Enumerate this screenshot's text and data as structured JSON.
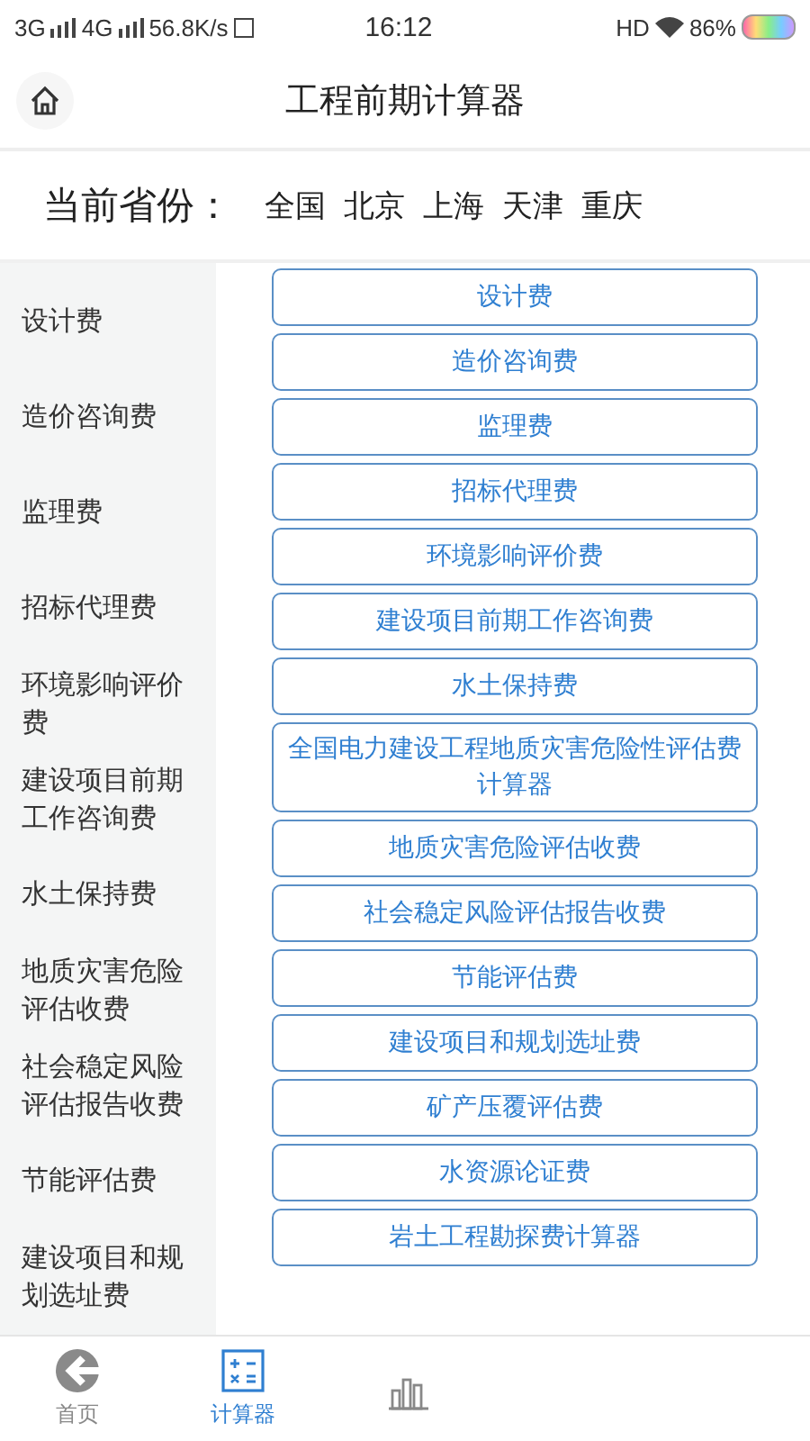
{
  "status_bar": {
    "network_1": "3G",
    "network_2": "4G",
    "speed": "56.8K/s",
    "time": "16:12",
    "hd": "HD",
    "battery": "86%"
  },
  "header": {
    "title": "工程前期计算器"
  },
  "province_bar": {
    "label": "当前省份：",
    "provinces": [
      "全国",
      "北京",
      "上海",
      "天津",
      "重庆"
    ]
  },
  "categories": [
    {
      "label": "设计费",
      "selected": false
    },
    {
      "label": "造价咨询费",
      "selected": false
    },
    {
      "label": "监理费",
      "selected": false
    },
    {
      "label": "招标代理费",
      "selected": false
    },
    {
      "label": "环境影响评价费",
      "selected": false
    },
    {
      "label": "建设项目前期工作咨询费",
      "selected": false
    },
    {
      "label": "水土保持费",
      "selected": false
    },
    {
      "label": "地质灾害危险评估收费",
      "selected": false
    },
    {
      "label": "社会稳定风险评估报告收费",
      "selected": false
    },
    {
      "label": "节能评估费",
      "selected": false
    },
    {
      "label": "建设项目和规划选址费",
      "selected": false
    }
  ],
  "calculators": [
    "设计费",
    "造价咨询费",
    "监理费",
    "招标代理费",
    "环境影响评价费",
    "建设项目前期工作咨询费",
    "水土保持费",
    "全国电力建设工程地质灾害危险性评估费计算器",
    "地质灾害危险评估收费",
    "社会稳定风险评估报告收费",
    "节能评估费",
    "建设项目和规划选址费",
    "矿产压覆评估费",
    "水资源论证费",
    "岩土工程勘探费计算器"
  ],
  "tab_bar": [
    {
      "kind": "back",
      "label": "首页",
      "selected": false
    },
    {
      "kind": "calculator",
      "label": "计算器",
      "selected": true
    },
    {
      "kind": "chart",
      "selected": false
    }
  ]
}
